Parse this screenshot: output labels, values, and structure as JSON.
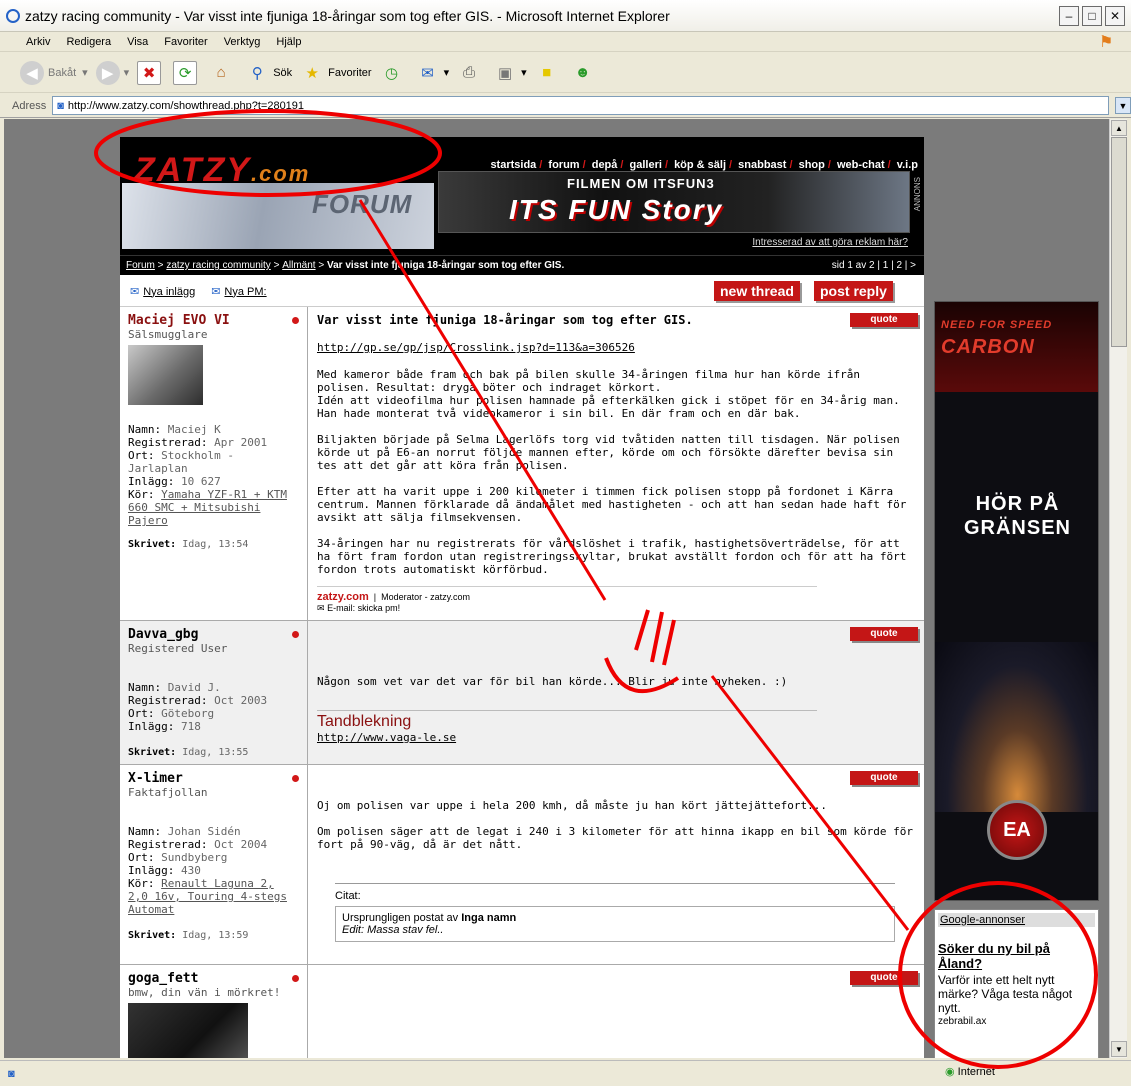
{
  "window": {
    "title": "zatzy racing community - Var visst inte fjuniga 18-åringar som tog efter GIS. - Microsoft Internet Explorer"
  },
  "menu": [
    "Arkiv",
    "Redigera",
    "Visa",
    "Favoriter",
    "Verktyg",
    "Hjälp"
  ],
  "toolbar": {
    "back": "Bakåt",
    "search": "Sök",
    "favorites": "Favoriter"
  },
  "address": {
    "label": "Adress",
    "url": "http://www.zatzy.com/showthread.php?t=280191"
  },
  "status": {
    "zone": "Internet"
  },
  "site": {
    "logo": "ZATZY",
    "logo_com": ".com",
    "nav": [
      "startsida",
      "forum",
      "depå",
      "galleri",
      "köp & sälj",
      "snabbast",
      "shop",
      "web-chat",
      "v.i.p"
    ],
    "forum_label": "FORUM",
    "banner_sub": "FILMEN OM ITSFUN3",
    "banner_title": "ITS FUN Story",
    "annons": "ANNONS",
    "ad_link": "Intresserad av att göra reklam här?",
    "crumb": {
      "forum": "Forum",
      "community": "zatzy racing community",
      "allmant": "Allmänt",
      "thread": "Var visst inte fjuniga 18-åringar som tog efter GIS.",
      "pages": "sid 1 av 2 | 1 | 2 | >"
    },
    "new_posts": "Nya inlägg",
    "new_pm": "Nya PM:",
    "new_thread": "new thread",
    "post_reply": "post reply",
    "quote": "quote"
  },
  "posts": [
    {
      "user": "Maciej EVO VI",
      "rank": "Sälsmugglare",
      "namn": "Maciej K",
      "reg": "Apr 2001",
      "ort": "Stockholm - Jarlaplan",
      "inlagg": "10 627",
      "kor": "Yamaha YZF-R1 + KTM 660 SMC + Mitsubishi Pajero",
      "skrivet": "Idag, 13:54",
      "title": "Var visst inte fjuniga 18-åringar som tog efter GIS.",
      "link": "http://gp.se/gp/jsp/Crosslink.jsp?d=113&a=306526",
      "p1": "Med kameror både fram och bak på bilen skulle 34-åringen filma hur han körde ifrån polisen. Resultat: dryga böter och indraget körkort.",
      "p1b": "Idén att videofilma hur polisen hamnade på efterkälken gick i stöpet för en 34-årig man. Han hade monterat två videokameror i sin bil. En där fram och en där bak.",
      "p2": "Biljakten började på Selma Lagerlöfs torg vid tvåtiden natten till tisdagen. När polisen körde ut på E6-an norrut följde mannen efter, körde om och försökte därefter bevisa sin tes att det går att köra från polisen.",
      "p3": "Efter att ha varit uppe i 200 kilometer i timmen fick polisen stopp på fordonet i Kärra centrum. Mannen förklarade då ändamålet med hastigheten - och att han sedan hade haft för avsikt att sälja filmsekvensen.",
      "p4": "34-åringen har nu registrerats för vårdslöshet i trafik, hastighetsöverträdelse, för att ha fört fram fordon utan registreringsskyltar, brukat avställt fordon och för att ha fört fordon trots automatiskt körförbud.",
      "sig_logo": "zatzy.com",
      "sig_role": "Moderator - zatzy.com",
      "sig_mail": "E-mail: skicka pm!"
    },
    {
      "user": "Davva_gbg",
      "rank": "Registered User",
      "namn": "David J.",
      "reg": "Oct 2003",
      "ort": "Göteborg",
      "inlagg": "718",
      "skrivet": "Idag, 13:55",
      "text": "Någon som vet var det var för bil han körde... Blir ju inte nyheken. :)",
      "sig": "Tandblekning",
      "sig_link": "http://www.vaga-le.se"
    },
    {
      "user": "X-limer",
      "rank": "Faktafjollan",
      "namn": "Johan Sidén",
      "reg": "Oct 2004",
      "ort": "Sundbyberg",
      "inlagg": "430",
      "kor": "Renault Laguna 2, 2,0 16v, Touring 4-stegs Automat",
      "skrivet": "Idag, 13:59",
      "t1": "Oj om polisen var uppe i hela 200 kmh, då måste ju han kört jättejättefort...",
      "t2": "Om polisen säger att de legat i 240 i 3 kilometer för att hinna ikapp en bil som körde för fort på 90-väg, då är det nått.",
      "citat": "Citat:",
      "orig": "Ursprungligen postat av",
      "orig_user": "Inga namn",
      "edit": "Edit: Massa stav fel.."
    },
    {
      "user": "goga_fett",
      "rank": "bmw, din vän i mörkret!"
    }
  ],
  "labels": {
    "namn": "Namn:",
    "reg": "Registrerad:",
    "ort": "Ort:",
    "inlagg": "Inlägg:",
    "kor": "Kör:",
    "skrivet": "Skrivet:"
  },
  "side": {
    "nfs1": "NEED FOR SPEED",
    "nfs2": "CARBON",
    "hor": "HÖR PÅ GRÄNSEN",
    "ea": "EA"
  },
  "gads": {
    "head": "Google-annonser",
    "title": "Söker du ny bil på Åland?",
    "desc": "Varför inte ett helt nytt märke? Våga testa något nytt.",
    "url": "zebrabil.ax"
  }
}
